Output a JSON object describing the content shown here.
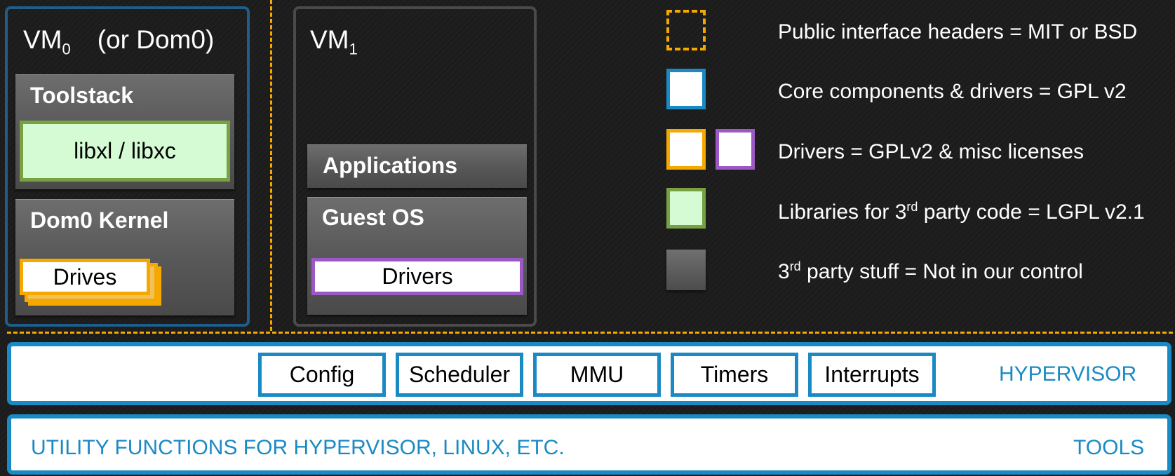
{
  "vm0": {
    "title_main": "VM",
    "title_sub": "0",
    "title_note": "(or Dom0)",
    "toolstack_label": "Toolstack",
    "libs_label": "libxl / libxc",
    "kernel_label": "Dom0 Kernel",
    "drives_label": "Drives"
  },
  "vm1": {
    "title_main": "VM",
    "title_sub": "1",
    "applications_label": "Applications",
    "guest_os_label": "Guest OS",
    "drivers_label": "Drivers"
  },
  "legend": {
    "public_headers": "Public interface headers = MIT or BSD",
    "core": "Core components & drivers = GPL v2",
    "drivers": "Drivers = GPLv2 & misc licenses",
    "libraries_prefix": "Libraries for 3",
    "libraries_sup": "rd",
    "libraries_suffix": " party code =  LGPL v2.1",
    "third_party_prefix": "3",
    "third_party_sup": "rd",
    "third_party_suffix": " party stuff = Not in our control"
  },
  "hypervisor": {
    "components": [
      "Config",
      "Scheduler",
      "MMU",
      "Timers",
      "Interrupts"
    ],
    "label": "HYPERVISOR"
  },
  "tools": {
    "description": "UTILITY FUNCTIONS FOR HYPERVISOR, LINUX, ETC.",
    "label": "TOOLS"
  },
  "colors": {
    "public_dashed": "#f5a800",
    "core_blue": "#1a8ac4",
    "drivers_orange": "#f5a800",
    "drivers_purple": "#9b59c5",
    "library_green": "#77a143",
    "library_fill": "#d4fbd4",
    "vm0_border": "#1f5d8a"
  }
}
